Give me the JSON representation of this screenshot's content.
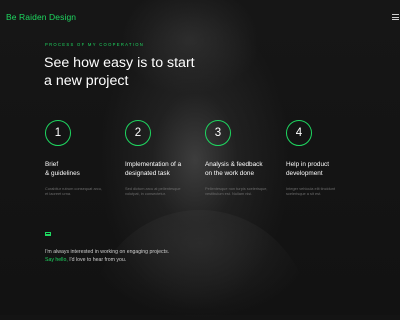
{
  "brand": {
    "logo": "Be Raiden Design",
    "accent": "#1ed760"
  },
  "header": {
    "menu_icon": "hamburger-icon"
  },
  "section": {
    "eyebrow": "PROCESS OF MY COOPERATION",
    "headline_line1": "See how easy is to start",
    "headline_line2": "a new project"
  },
  "steps": [
    {
      "number": "1",
      "title_line1": "Brief",
      "title_line2": "& guidelines",
      "desc_line1": "Curabitur rutrum consequat arcu,",
      "desc_line2": "et laoreet urna."
    },
    {
      "number": "2",
      "title_line1": "Implementation of a",
      "title_line2": "designated task",
      "desc_line1": "Sed dictum arcu at pellentesque",
      "desc_line2": "volutpat, in consectetur."
    },
    {
      "number": "3",
      "title_line1": "Analysis & feedback",
      "title_line2": "on the work done",
      "desc_line1": "Pellentesque non turpis scelerisque,",
      "desc_line2": "vestibulum est. Nullam nisi."
    },
    {
      "number": "4",
      "title_line1": "Help in product",
      "title_line2": "development",
      "desc_line1": "Integer vehicula elit tincidunt",
      "desc_line2": "scelerisque a sit est."
    }
  ],
  "contact": {
    "icon": "mail-icon",
    "text_line1": "I'm always interested in working on engaging projects.",
    "link": "Say hello,",
    "text_line2_rest": " I'd love to hear from you."
  }
}
